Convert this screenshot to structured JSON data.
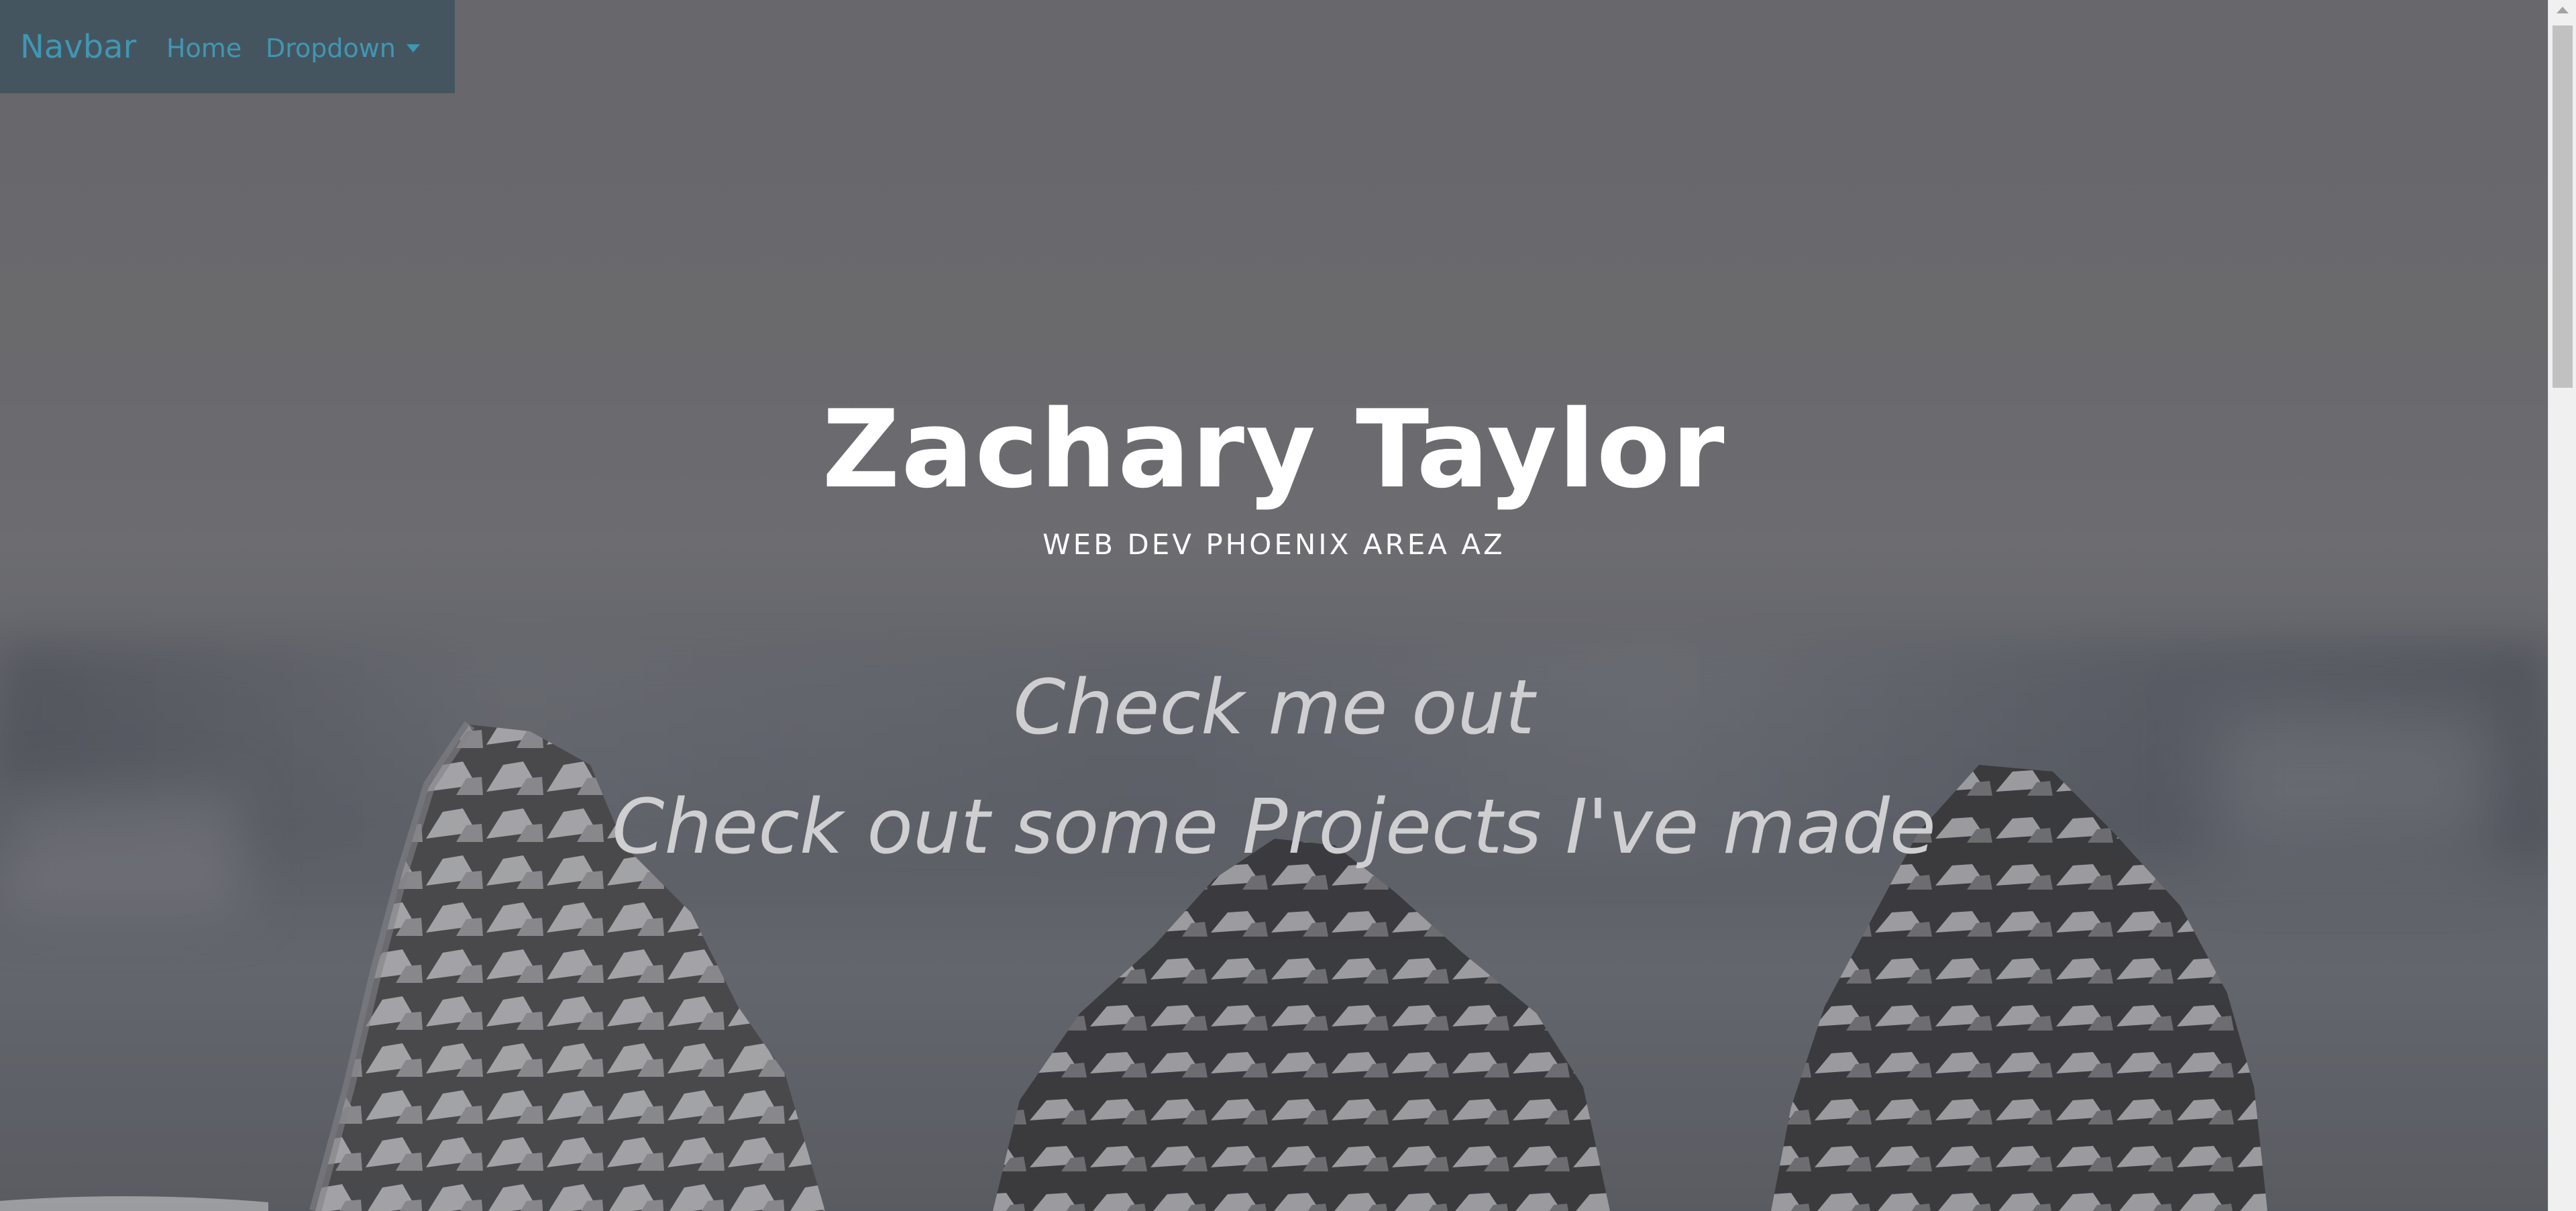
{
  "navbar": {
    "brand": "Navbar",
    "links": [
      {
        "label": "Home"
      },
      {
        "label": "Dropdown"
      }
    ]
  },
  "hero": {
    "title": "Zachary Taylor",
    "subtitle": "WEB DEV PHOENIX AREA AZ",
    "cta_primary": "Check me out",
    "cta_secondary": "Check out some Projects I've made"
  },
  "icons": {
    "dropdown": "caret-down-icon",
    "scroll_up": "arrow-up-icon"
  },
  "colors": {
    "nav_link": "#3f97b3",
    "title": "#ffffff",
    "cta": "#cfcfd2",
    "overlay": "#707073"
  }
}
